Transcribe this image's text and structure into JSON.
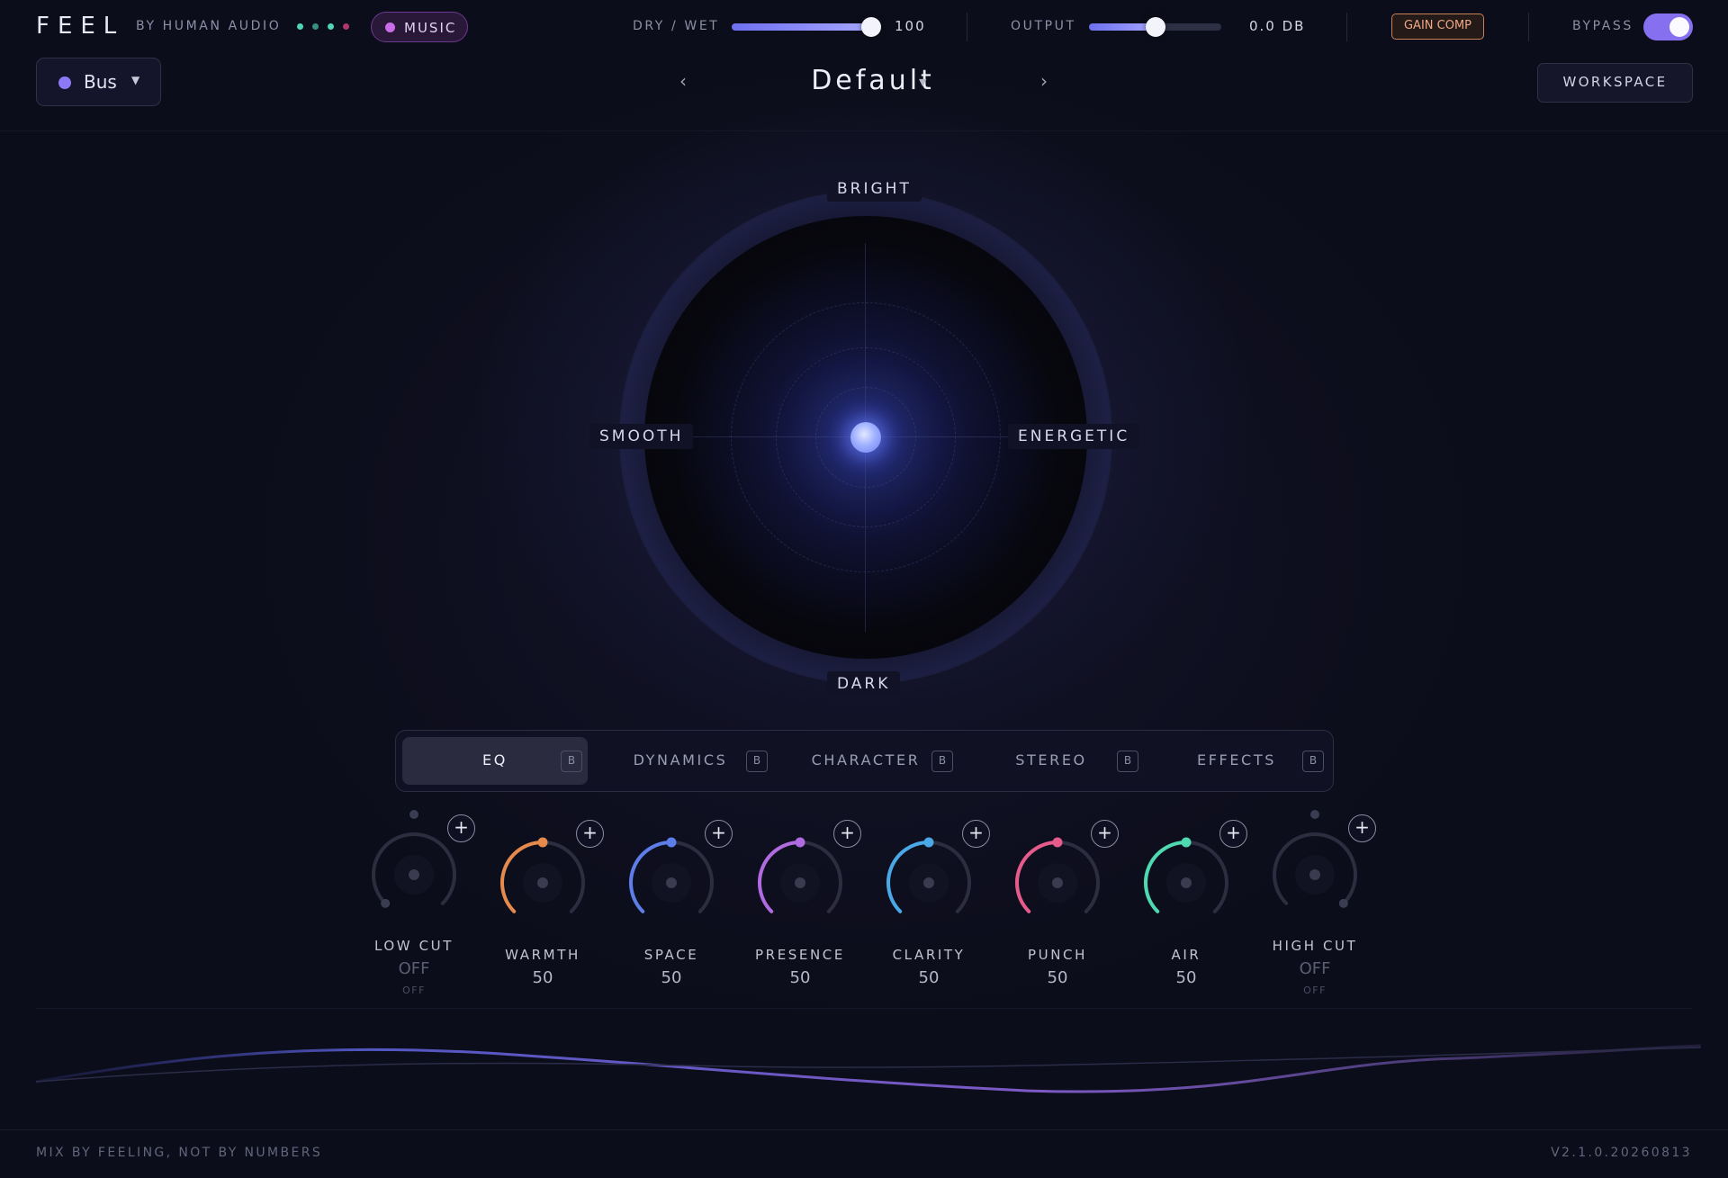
{
  "app": {
    "logo": "FEEL",
    "byline": "BY HUMAN AUDIO",
    "status_dots": [
      "#4fd6b4",
      "#3a8f82",
      "#4fd6b4",
      "#b0366e"
    ],
    "mode": "MUSIC"
  },
  "top": {
    "drywet_label": "DRY / WET",
    "drywet_value": "100",
    "drywet_fraction": 1.0,
    "output_label": "OUTPUT",
    "output_value": "0.0 DB",
    "output_fraction": 0.5,
    "gaincomp_label": "GAIN COMP",
    "bypass_label": "BYPASS",
    "bypass_on": true
  },
  "bus": {
    "label": "Bus",
    "color": "#8b79f5"
  },
  "preset": {
    "name": "Default",
    "prev_icon": "‹",
    "next_icon": "›"
  },
  "workspace_label": "WORKSPACE",
  "pad": {
    "top": "BRIGHT",
    "bottom": "DARK",
    "left": "SMOOTH",
    "right": "ENERGETIC"
  },
  "tabs": [
    {
      "label": "EQ",
      "badge": "B",
      "active": true
    },
    {
      "label": "DYNAMICS",
      "badge": "B",
      "active": false
    },
    {
      "label": "CHARACTER",
      "badge": "B",
      "active": false
    },
    {
      "label": "STEREO",
      "badge": "B",
      "active": false
    },
    {
      "label": "EFFECTS",
      "badge": "B",
      "active": false
    }
  ],
  "knobs": [
    {
      "name": "LOW CUT",
      "value": "OFF",
      "sub": "OFF",
      "off": true,
      "color": "#3a3c52"
    },
    {
      "name": "WARMTH",
      "value": "50",
      "off": false,
      "color": "#e58a4c"
    },
    {
      "name": "SPACE",
      "value": "50",
      "off": false,
      "color": "#5d7ee8"
    },
    {
      "name": "PRESENCE",
      "value": "50",
      "off": false,
      "color": "#b06be0"
    },
    {
      "name": "CLARITY",
      "value": "50",
      "off": false,
      "color": "#4aa8e6"
    },
    {
      "name": "PUNCH",
      "value": "50",
      "off": false,
      "color": "#e65a8c"
    },
    {
      "name": "AIR",
      "value": "50",
      "off": false,
      "color": "#4fd9b0"
    },
    {
      "name": "HIGH CUT",
      "value": "OFF",
      "sub": "OFF",
      "off": true,
      "color": "#3a3c52"
    }
  ],
  "footer": {
    "tagline": "MIX BY FEELING, NOT BY NUMBERS",
    "version": "V2.1.0.20260813"
  }
}
